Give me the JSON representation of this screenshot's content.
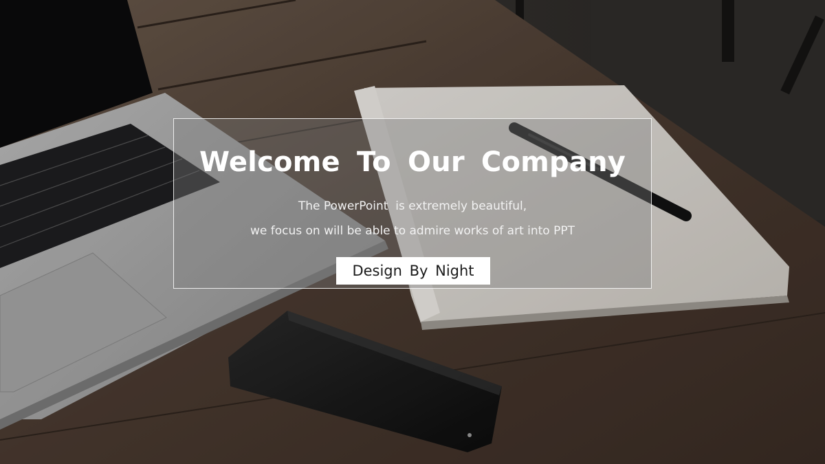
{
  "slide": {
    "title": "Welcome  To  Our  Company",
    "subtitle_line1": "The PowerPoint  is extremely beautiful,",
    "subtitle_line2": "we focus on will be able to admire works of art into PPT",
    "badge": "Design  By  Night"
  },
  "colors": {
    "overlay_border": "#ffffff",
    "badge_background": "#ffffff",
    "badge_text": "#1a1a1a",
    "title_text": "#ffffff"
  }
}
